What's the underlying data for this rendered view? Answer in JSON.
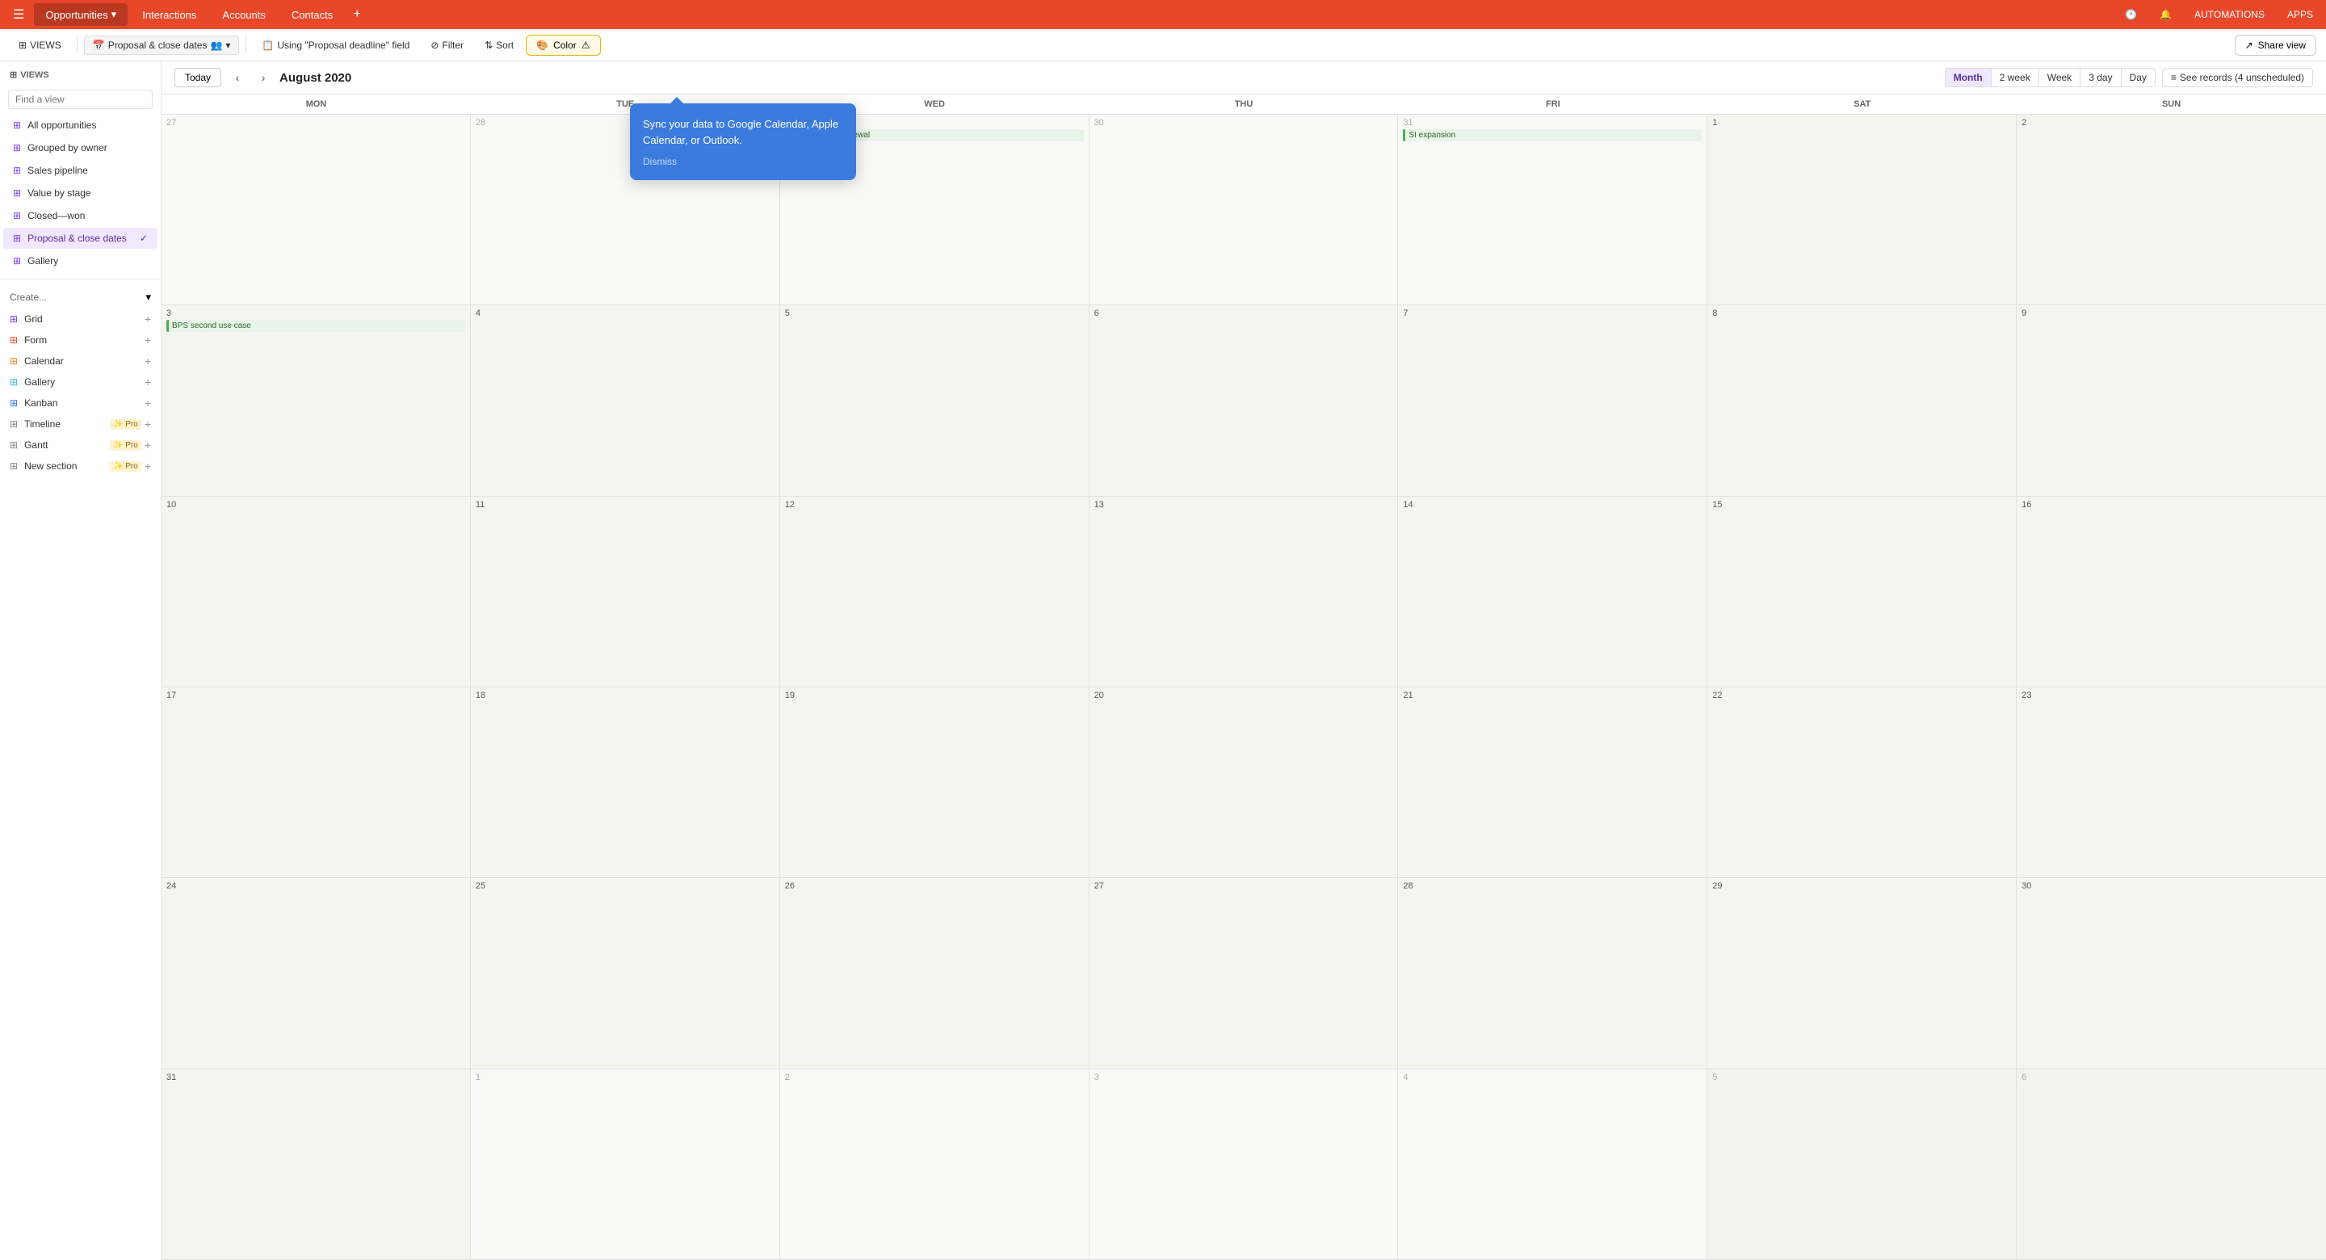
{
  "app": {
    "hamburger": "☰"
  },
  "topnav": {
    "tabs": [
      {
        "id": "opportunities",
        "label": "Opportunities",
        "active": true,
        "hasDropdown": true
      },
      {
        "id": "interactions",
        "label": "Interactions",
        "active": false
      },
      {
        "id": "accounts",
        "label": "Accounts",
        "active": false
      },
      {
        "id": "contacts",
        "label": "Contacts",
        "active": false
      }
    ],
    "add_icon": "+",
    "automations_label": "AUTOMATIONS",
    "apps_label": "APPS"
  },
  "toolbar": {
    "views_label": "VIEWS",
    "view_name": "Proposal & close dates",
    "people_icon": "👥",
    "field_label": "Using \"Proposal deadline\" field",
    "filter_label": "Filter",
    "sort_label": "Sort",
    "color_label": "Color",
    "share_label": "Share view"
  },
  "sidebar": {
    "search_placeholder": "Find a view",
    "views_header": "VIEWS",
    "items": [
      {
        "id": "all-opportunities",
        "label": "All opportunities",
        "icon": "⊞",
        "iconClass": "grid-icon"
      },
      {
        "id": "grouped-by-owner",
        "label": "Grouped by owner",
        "icon": "⊞",
        "iconClass": "grid-icon"
      },
      {
        "id": "sales-pipeline",
        "label": "Sales pipeline",
        "icon": "⊞",
        "iconClass": "grid-icon"
      },
      {
        "id": "value-by-stage",
        "label": "Value by stage",
        "icon": "⊞",
        "iconClass": "grid-icon"
      },
      {
        "id": "closed-won",
        "label": "Closed—won",
        "icon": "⊞",
        "iconClass": "grid-icon"
      },
      {
        "id": "proposal-close-dates",
        "label": "Proposal & close dates",
        "icon": "⊞",
        "iconClass": "grid-icon",
        "active": true
      },
      {
        "id": "gallery",
        "label": "Gallery",
        "icon": "⊞",
        "iconClass": "grid-icon"
      }
    ],
    "create_label": "Create...",
    "create_items": [
      {
        "id": "grid",
        "label": "Grid",
        "icon": "⊞",
        "iconClass": "grid-icon",
        "pro": false
      },
      {
        "id": "form",
        "label": "Form",
        "icon": "⊞",
        "iconClass": "grid-icon-red",
        "pro": false
      },
      {
        "id": "calendar",
        "label": "Calendar",
        "icon": "⊞",
        "iconClass": "grid-icon-orange",
        "pro": false
      },
      {
        "id": "gallery-create",
        "label": "Gallery",
        "icon": "⊞",
        "iconClass": "grid-icon-teal",
        "pro": false
      },
      {
        "id": "kanban",
        "label": "Kanban",
        "icon": "⊞",
        "iconClass": "grid-icon-blue",
        "pro": false
      },
      {
        "id": "timeline",
        "label": "Timeline",
        "icon": "⊞",
        "iconClass": "grid-icon-gray",
        "pro": true
      },
      {
        "id": "gantt",
        "label": "Gantt",
        "icon": "⊞",
        "iconClass": "grid-icon-gray",
        "pro": true
      },
      {
        "id": "new-section",
        "label": "New section",
        "icon": "⊞",
        "iconClass": "grid-icon-gray",
        "pro": true
      }
    ]
  },
  "calendar": {
    "current_month": "August 2020",
    "today_label": "Today",
    "view_buttons": [
      {
        "id": "month",
        "label": "Month",
        "active": true
      },
      {
        "id": "2week",
        "label": "2 week",
        "active": false
      },
      {
        "id": "week",
        "label": "Week",
        "active": false
      },
      {
        "id": "3day",
        "label": "3 day",
        "active": false
      },
      {
        "id": "day",
        "label": "Day",
        "active": false
      }
    ],
    "records_label": "See records (4 unscheduled)",
    "day_names": [
      "Mon",
      "Tue",
      "Wed",
      "Thu",
      "Fri",
      "Sat",
      "Sun"
    ],
    "weeks": [
      {
        "days": [
          {
            "date": "27",
            "other_month": true,
            "weekend": false
          },
          {
            "date": "28",
            "other_month": true,
            "weekend": false
          },
          {
            "date": "29",
            "other_month": true,
            "weekend": false,
            "event": "Robinetworks renewal"
          },
          {
            "date": "30",
            "other_month": true,
            "weekend": false
          },
          {
            "date": "31",
            "other_month": true,
            "weekend": false,
            "event": "SI expansion"
          },
          {
            "date": "1",
            "other_month": false,
            "weekend": true
          },
          {
            "date": "2",
            "other_month": false,
            "weekend": true
          }
        ]
      },
      {
        "days": [
          {
            "date": "3",
            "other_month": false,
            "weekend": false,
            "event": "BPS second use case"
          },
          {
            "date": "4",
            "other_month": false,
            "weekend": false
          },
          {
            "date": "5",
            "other_month": false,
            "weekend": false
          },
          {
            "date": "6",
            "other_month": false,
            "weekend": false
          },
          {
            "date": "7",
            "other_month": false,
            "weekend": false
          },
          {
            "date": "8",
            "other_month": false,
            "weekend": true
          },
          {
            "date": "9",
            "other_month": false,
            "weekend": true
          }
        ]
      },
      {
        "days": [
          {
            "date": "10",
            "other_month": false,
            "weekend": false
          },
          {
            "date": "11",
            "other_month": false,
            "weekend": false
          },
          {
            "date": "12",
            "other_month": false,
            "weekend": false
          },
          {
            "date": "13",
            "other_month": false,
            "weekend": false
          },
          {
            "date": "14",
            "other_month": false,
            "weekend": false
          },
          {
            "date": "15",
            "other_month": false,
            "weekend": true
          },
          {
            "date": "16",
            "other_month": false,
            "weekend": true
          }
        ]
      },
      {
        "days": [
          {
            "date": "17",
            "other_month": false,
            "weekend": false
          },
          {
            "date": "18",
            "other_month": false,
            "weekend": false
          },
          {
            "date": "19",
            "other_month": false,
            "weekend": false
          },
          {
            "date": "20",
            "other_month": false,
            "weekend": false
          },
          {
            "date": "21",
            "other_month": false,
            "weekend": false
          },
          {
            "date": "22",
            "other_month": false,
            "weekend": true
          },
          {
            "date": "23",
            "other_month": false,
            "weekend": true
          }
        ]
      },
      {
        "days": [
          {
            "date": "24",
            "other_month": false,
            "weekend": false
          },
          {
            "date": "25",
            "other_month": false,
            "weekend": false
          },
          {
            "date": "26",
            "other_month": false,
            "weekend": false
          },
          {
            "date": "27",
            "other_month": false,
            "weekend": false
          },
          {
            "date": "28",
            "other_month": false,
            "weekend": false
          },
          {
            "date": "29",
            "other_month": false,
            "weekend": true
          },
          {
            "date": "30",
            "other_month": false,
            "weekend": true
          }
        ]
      },
      {
        "days": [
          {
            "date": "31",
            "other_month": false,
            "weekend": false
          },
          {
            "date": "1",
            "other_month": true,
            "weekend": false
          },
          {
            "date": "2",
            "other_month": true,
            "weekend": false
          },
          {
            "date": "3",
            "other_month": true,
            "weekend": false
          },
          {
            "date": "4",
            "other_month": true,
            "weekend": false
          },
          {
            "date": "5",
            "other_month": true,
            "weekend": true
          },
          {
            "date": "6",
            "other_month": true,
            "weekend": true
          }
        ]
      }
    ]
  },
  "sync_tooltip": {
    "text": "Sync your data to Google Calendar, Apple Calendar, or Outlook.",
    "dismiss_label": "Dismiss"
  }
}
